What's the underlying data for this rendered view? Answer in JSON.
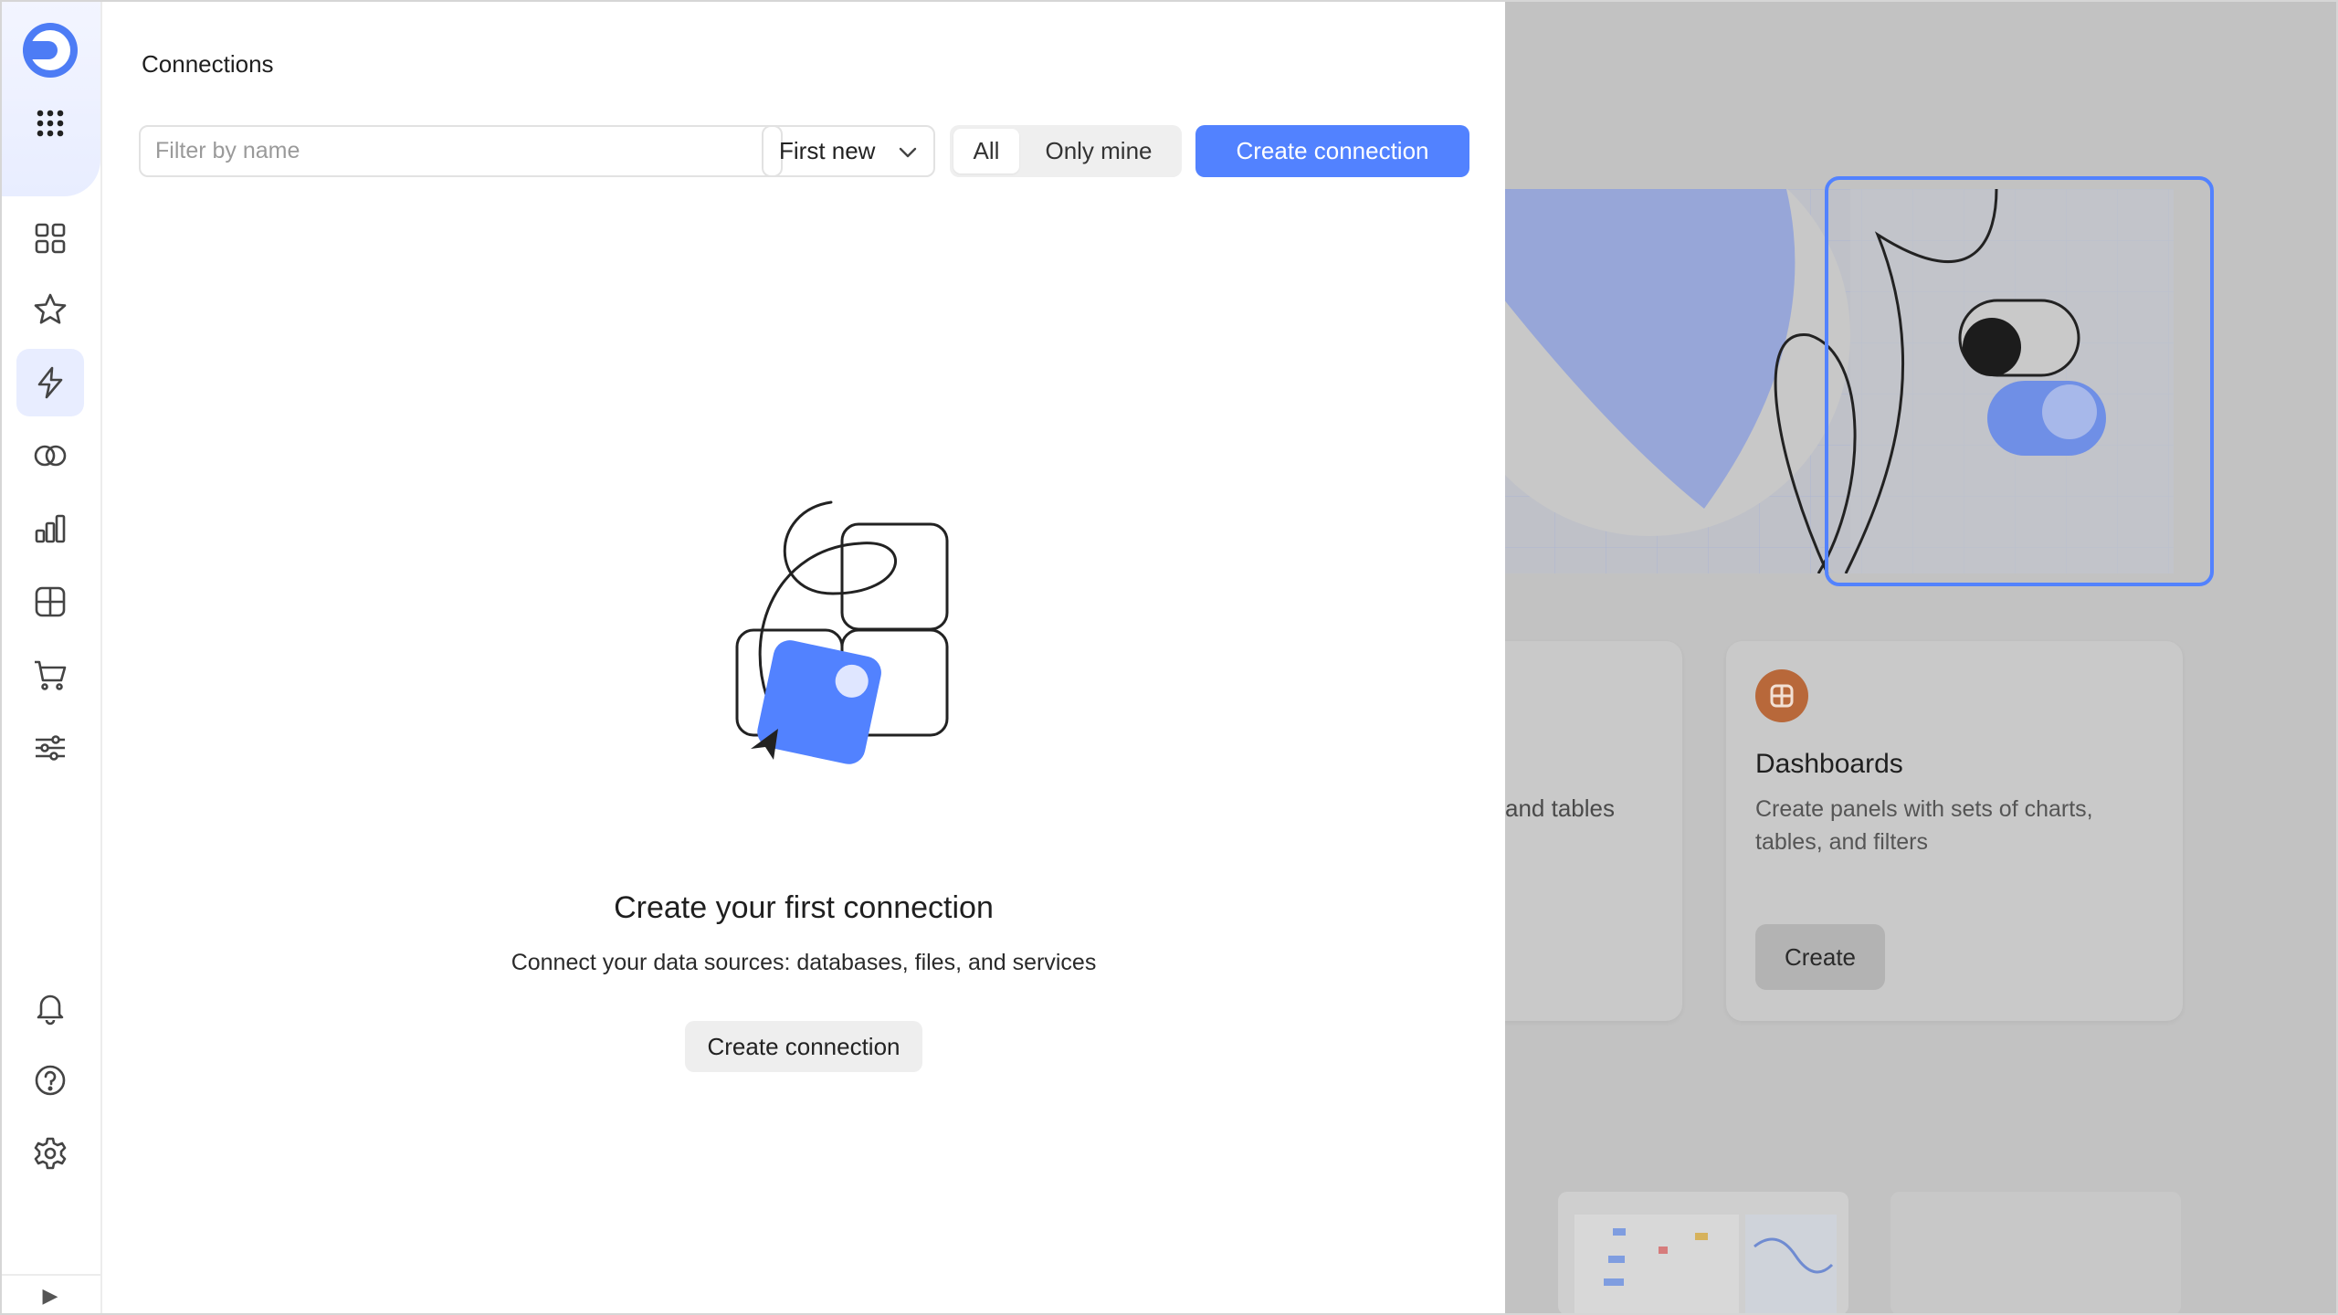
{
  "panel": {
    "title": "Connections",
    "filter_placeholder": "Filter by name",
    "sort_value": "First new",
    "segment": {
      "all": "All",
      "only_mine": "Only mine"
    },
    "create_button": "Create connection",
    "empty": {
      "title": "Create your first connection",
      "description": "Connect your data sources: databases, files, and services",
      "button": "Create connection"
    }
  },
  "rail": {
    "items": [
      "logo-icon",
      "apps-grid-icon",
      "collections-icon",
      "favorites-star-icon",
      "connections-bolt-icon",
      "datasets-icon",
      "charts-icon",
      "dashboards-icon",
      "marketplace-cart-icon",
      "settings-sliders-icon",
      "notifications-bell-icon",
      "help-icon",
      "settings-gear-icon"
    ],
    "collapse_icon": "▶"
  },
  "background": {
    "card_partial_text": "and tables",
    "card_title": "Dashboards",
    "card_description": "Create panels with sets of charts, tables, and filters",
    "card_button": "Create"
  },
  "colors": {
    "accent": "#5282ff",
    "dashboard_icon": "#b8683a"
  }
}
